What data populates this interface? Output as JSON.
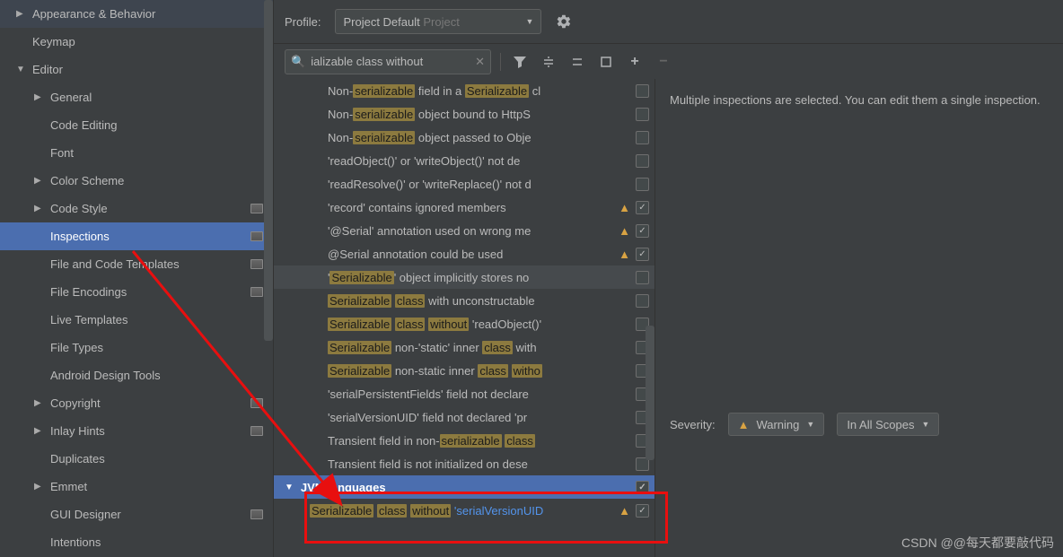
{
  "sidebar": {
    "items": [
      {
        "label": "Appearance & Behavior",
        "level": 0,
        "chev": "▶",
        "gutter": false
      },
      {
        "label": "Keymap",
        "level": 0,
        "chev": "",
        "gutter": false
      },
      {
        "label": "Editor",
        "level": 0,
        "chev": "▼",
        "gutter": false
      },
      {
        "label": "General",
        "level": 1,
        "chev": "▶",
        "gutter": false
      },
      {
        "label": "Code Editing",
        "level": 1,
        "chev": "",
        "gutter": false
      },
      {
        "label": "Font",
        "level": 1,
        "chev": "",
        "gutter": false
      },
      {
        "label": "Color Scheme",
        "level": 1,
        "chev": "▶",
        "gutter": false
      },
      {
        "label": "Code Style",
        "level": 1,
        "chev": "▶",
        "gutter": true
      },
      {
        "label": "Inspections",
        "level": 1,
        "chev": "",
        "gutter": true,
        "selected": true
      },
      {
        "label": "File and Code Templates",
        "level": 1,
        "chev": "",
        "gutter": true
      },
      {
        "label": "File Encodings",
        "level": 1,
        "chev": "",
        "gutter": true
      },
      {
        "label": "Live Templates",
        "level": 1,
        "chev": "",
        "gutter": false
      },
      {
        "label": "File Types",
        "level": 1,
        "chev": "",
        "gutter": false
      },
      {
        "label": "Android Design Tools",
        "level": 1,
        "chev": "",
        "gutter": false
      },
      {
        "label": "Copyright",
        "level": 1,
        "chev": "▶",
        "gutter": true
      },
      {
        "label": "Inlay Hints",
        "level": 1,
        "chev": "▶",
        "gutter": true
      },
      {
        "label": "Duplicates",
        "level": 1,
        "chev": "",
        "gutter": false
      },
      {
        "label": "Emmet",
        "level": 1,
        "chev": "▶",
        "gutter": false
      },
      {
        "label": "GUI Designer",
        "level": 1,
        "chev": "",
        "gutter": true
      },
      {
        "label": "Intentions",
        "level": 1,
        "chev": "",
        "gutter": false
      }
    ]
  },
  "topbar": {
    "profile_label": "Profile:",
    "profile_value": "Project Default",
    "profile_suffix": "Project"
  },
  "search": {
    "value": "ializable class without"
  },
  "inspections": [
    {
      "segments": [
        {
          "t": "Non-"
        },
        {
          "t": "serializable",
          "h": 1
        },
        {
          "t": " field in a "
        },
        {
          "t": "Serializable",
          "h": 1
        },
        {
          "t": " cl"
        }
      ],
      "warn": false,
      "checked": false
    },
    {
      "segments": [
        {
          "t": "Non-"
        },
        {
          "t": "serializable",
          "h": 1
        },
        {
          "t": " object bound to HttpS"
        }
      ],
      "warn": false,
      "checked": false
    },
    {
      "segments": [
        {
          "t": "Non-"
        },
        {
          "t": "serializable",
          "h": 1
        },
        {
          "t": " object passed to Obje"
        }
      ],
      "warn": false,
      "checked": false
    },
    {
      "segments": [
        {
          "t": "'readObject()' or 'writeObject()' not de"
        }
      ],
      "warn": false,
      "checked": false
    },
    {
      "segments": [
        {
          "t": "'readResolve()' or 'writeReplace()' not d"
        }
      ],
      "warn": false,
      "checked": false
    },
    {
      "segments": [
        {
          "t": "'record' contains ignored members"
        }
      ],
      "warn": true,
      "checked": true
    },
    {
      "segments": [
        {
          "t": "'@Serial' annotation used on wrong me"
        }
      ],
      "warn": true,
      "checked": true
    },
    {
      "segments": [
        {
          "t": "@Serial annotation could be used"
        }
      ],
      "warn": true,
      "checked": true
    },
    {
      "segments": [
        {
          "t": "'"
        },
        {
          "t": "Serializable",
          "h": 1
        },
        {
          "t": "' object implicitly stores no"
        }
      ],
      "warn": false,
      "checked": false,
      "hov": true
    },
    {
      "segments": [
        {
          "t": "Serializable",
          "h": 1
        },
        {
          "t": " "
        },
        {
          "t": "class",
          "h": 1
        },
        {
          "t": " with unconstructable "
        }
      ],
      "warn": false,
      "checked": false
    },
    {
      "segments": [
        {
          "t": "Serializable",
          "h": 1
        },
        {
          "t": " "
        },
        {
          "t": "class",
          "h": 1
        },
        {
          "t": " "
        },
        {
          "t": "without",
          "h": 1
        },
        {
          "t": " 'readObject()'"
        }
      ],
      "warn": false,
      "checked": false
    },
    {
      "segments": [
        {
          "t": "Serializable",
          "h": 1
        },
        {
          "t": " non-'static' inner "
        },
        {
          "t": "class",
          "h": 1
        },
        {
          "t": " with"
        }
      ],
      "warn": false,
      "checked": false
    },
    {
      "segments": [
        {
          "t": "Serializable",
          "h": 1
        },
        {
          "t": " non-static inner "
        },
        {
          "t": "class",
          "h": 1
        },
        {
          "t": " "
        },
        {
          "t": "witho",
          "h": 1
        }
      ],
      "warn": false,
      "checked": false
    },
    {
      "segments": [
        {
          "t": "'serialPersistentFields' field not declare"
        }
      ],
      "warn": false,
      "checked": false
    },
    {
      "segments": [
        {
          "t": "'serialVersionUID' field not declared 'pr"
        }
      ],
      "warn": false,
      "checked": false
    },
    {
      "segments": [
        {
          "t": "Transient field in non-"
        },
        {
          "t": "serializable",
          "h": 1
        },
        {
          "t": " "
        },
        {
          "t": "class",
          "h": 1
        }
      ],
      "warn": false,
      "checked": false
    },
    {
      "segments": [
        {
          "t": "Transient field is not initialized on dese"
        }
      ],
      "warn": false,
      "checked": false
    }
  ],
  "category": {
    "label": "JVM languages",
    "checked": true
  },
  "category_child": {
    "segments": [
      {
        "t": "Serializable",
        "h": 1
      },
      {
        "t": " "
      },
      {
        "t": "class",
        "h": 1
      },
      {
        "t": " "
      },
      {
        "t": "without",
        "h": 1
      },
      {
        "t": " "
      },
      {
        "t": "'serialVersionUID",
        "h": 2
      }
    ],
    "warn": true,
    "checked": true
  },
  "details": {
    "msg": "Multiple inspections are selected. You can edit them a single inspection.",
    "severity_label": "Severity:",
    "severity_value": "Warning",
    "scope_value": "In All Scopes"
  },
  "watermark": "CSDN @@每天都要敲代码"
}
